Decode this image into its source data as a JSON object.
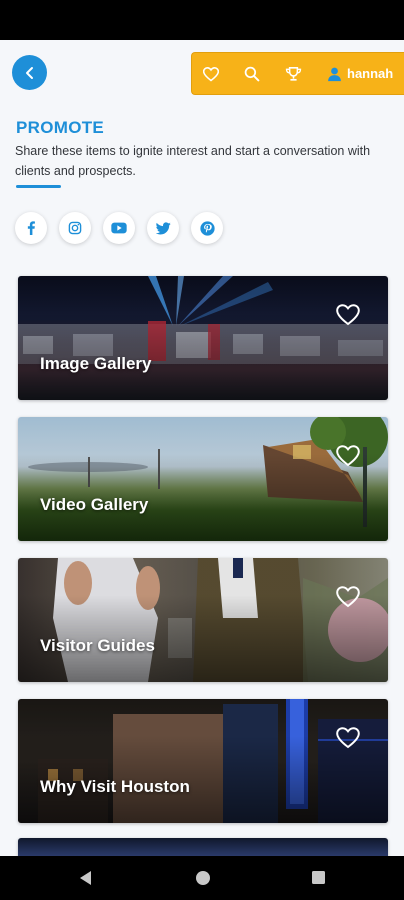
{
  "header": {
    "user_name": "hannah",
    "icons": [
      "chevron-left-icon",
      "heart-icon",
      "search-icon",
      "trophy-icon",
      "user-icon"
    ]
  },
  "section": {
    "title": "PROMOTE",
    "description": "Share these items to ignite interest and start a conversation with clients and prospects."
  },
  "social": [
    "facebook-icon",
    "instagram-icon",
    "youtube-icon",
    "twitter-icon",
    "pinterest-icon"
  ],
  "cards": [
    {
      "title": "Image Gallery"
    },
    {
      "title": "Video Gallery"
    },
    {
      "title": "Visitor Guides"
    },
    {
      "title": "Why Visit Houston"
    }
  ],
  "colors": {
    "accent": "#1e8fd8",
    "topbar": "#f7b218",
    "background": "#f5f7fa"
  }
}
